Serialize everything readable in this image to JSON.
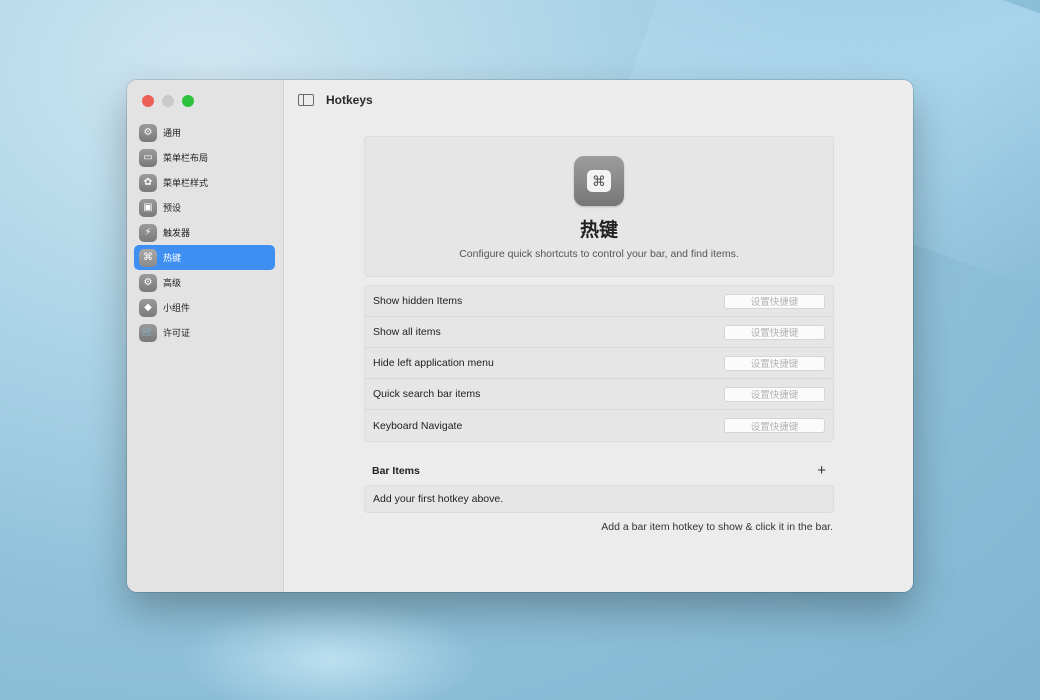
{
  "window": {
    "title": "Hotkeys"
  },
  "sidebar": {
    "items": [
      {
        "label": "通用",
        "icon": "gear-icon",
        "glyph": "⚙"
      },
      {
        "label": "菜单栏布局",
        "icon": "menubar-layout-icon",
        "glyph": "▭"
      },
      {
        "label": "菜单栏样式",
        "icon": "palette-icon",
        "glyph": "✿"
      },
      {
        "label": "预设",
        "icon": "preset-icon",
        "glyph": "▣"
      },
      {
        "label": "触发器",
        "icon": "bolt-icon",
        "glyph": "⚡"
      },
      {
        "label": "热键",
        "icon": "command-key-icon",
        "glyph": "⌘"
      },
      {
        "label": "高级",
        "icon": "advanced-gears-icon",
        "glyph": "⚙"
      },
      {
        "label": "小组件",
        "icon": "cube-icon",
        "glyph": "◆"
      },
      {
        "label": "许可证",
        "icon": "cart-icon",
        "glyph": "🛒"
      }
    ],
    "active_index": 5
  },
  "hero": {
    "icon": "command-key-icon",
    "glyph": "⌘",
    "title": "热键",
    "subtitle": "Configure quick shortcuts to control your bar, and find items."
  },
  "hotkeys": [
    {
      "label": "Show hidden Items",
      "placeholder": "设置快捷键"
    },
    {
      "label": "Show all items",
      "placeholder": "设置快捷键"
    },
    {
      "label": "Hide left application menu",
      "placeholder": "设置快捷键"
    },
    {
      "label": "Quick search bar items",
      "placeholder": "设置快捷键"
    },
    {
      "label": "Keyboard Navigate",
      "placeholder": "设置快捷键"
    }
  ],
  "bar_items": {
    "title": "Bar Items",
    "add_label": "+",
    "empty_text": "Add your first hotkey above.",
    "hint": "Add a bar item hotkey to show & click it in the bar."
  },
  "colors": {
    "accent": "#3f8ff2",
    "traffic_red": "#ee5f57",
    "traffic_gray": "#c9c9c9",
    "traffic_green": "#2dc33f"
  }
}
